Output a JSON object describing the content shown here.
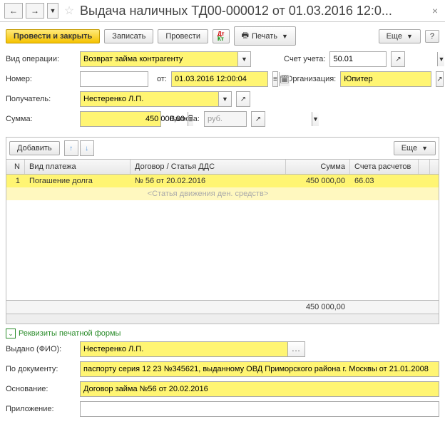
{
  "title": "Выдача наличных ТД00-000012 от 01.03.2016 12:0...",
  "toolbar": {
    "post_close": "Провести и закрыть",
    "save": "Записать",
    "post": "Провести",
    "print": "Печать",
    "more": "Еще"
  },
  "labels": {
    "op_type": "Вид операции:",
    "account": "Счет учета:",
    "number": "Номер:",
    "from": "от:",
    "org": "Организация:",
    "payee": "Получатель:",
    "sum": "Сумма:",
    "currency": "Валюта:",
    "add": "Добавить",
    "more": "Еще",
    "print_section": "Реквизиты печатной формы",
    "issued": "Выдано (ФИО):",
    "by_doc": "По документу:",
    "basis": "Основание:",
    "attach": "Приложение:"
  },
  "values": {
    "op_type": "Возврат займа контрагенту",
    "account": "50.01",
    "number": "",
    "date": "01.03.2016 12:00:04",
    "org": "Юпитер",
    "payee": "Нестеренко Л.П.",
    "sum": "450 000,00",
    "currency": "руб.",
    "issued": "Нестеренко Л.П.",
    "by_doc": "паспорту серия 12 23 №345621, выданному ОВД Приморского района г. Москвы от 21.01.2008",
    "basis": "Договор займа №56 от 20.02.2016",
    "attach": ""
  },
  "grid": {
    "headers": {
      "n": "N",
      "type": "Вид платежа",
      "contract": "Договор / Статья ДДС",
      "sum": "Сумма",
      "account": "Счета расчетов"
    },
    "rows": [
      {
        "n": "1",
        "type": "Погашение долга",
        "contract": "№ 56 от 20.02.2016",
        "sum": "450 000,00",
        "account": "66.03"
      }
    ],
    "placeholder": "<Статья движения ден. средств>",
    "footer_sum": "450 000,00"
  }
}
